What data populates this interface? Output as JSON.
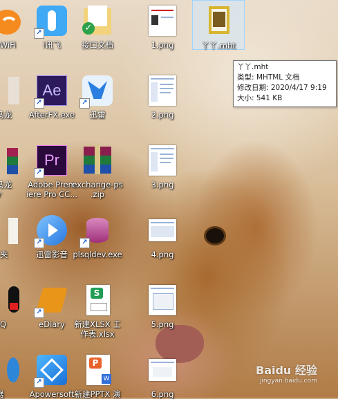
{
  "desktop": {
    "icons": [
      {
        "id": "wifi",
        "label": "猎豹WiFi"
      },
      {
        "id": "ixunfei",
        "label": "i讯飞"
      },
      {
        "id": "jiekou",
        "label": "接口文档"
      },
      {
        "id": "png1",
        "label": "1.png"
      },
      {
        "id": "mht",
        "label": "丫丫.mht"
      },
      {
        "id": "kdxf",
        "label": "科马龙"
      },
      {
        "id": "afterfx",
        "label": "AfterFX.exe"
      },
      {
        "id": "xunlei",
        "label": "迅雷"
      },
      {
        "id": "png2",
        "label": "2.png"
      },
      {
        "id": "kdxf2",
        "label": "科马龙\nr"
      },
      {
        "id": "premiere",
        "label": "Adobe Prem\niere Pro CC..."
      },
      {
        "id": "exchange",
        "label": "exchange-ps\n.zip"
      },
      {
        "id": "png3",
        "label": "3.png"
      },
      {
        "id": "folder",
        "label": "件夹"
      },
      {
        "id": "xlyy",
        "label": "迅雷影音"
      },
      {
        "id": "plsql",
        "label": "plsqldev.exe"
      },
      {
        "id": "png4",
        "label": "4.png"
      },
      {
        "id": "qq",
        "label": "QQ"
      },
      {
        "id": "ediary",
        "label": "eDiary"
      },
      {
        "id": "xlsx",
        "label": "新建XLSX 工\n作表.xlsx"
      },
      {
        "id": "png5",
        "label": "5.png"
      },
      {
        "id": "ie",
        "label": "器"
      },
      {
        "id": "apowersoft",
        "label": "Apowersoft"
      },
      {
        "id": "pptx",
        "label": "新建PPTX 演"
      },
      {
        "id": "png6",
        "label": "6.png"
      }
    ]
  },
  "tooltip": {
    "name": "丫丫.mht",
    "type": "类型: MHTML 文档",
    "modified": "修改日期: 2020/4/17 9:19",
    "size": "大小: 541 KB"
  },
  "watermark": {
    "brand": "Baidu 经验",
    "url": "jingyan.baidu.com"
  },
  "colors": {
    "selection": "#cde8ff",
    "ae": "#2d1a5c",
    "pr": "#2a0a3a",
    "xunlei": "#2a7fe0"
  }
}
